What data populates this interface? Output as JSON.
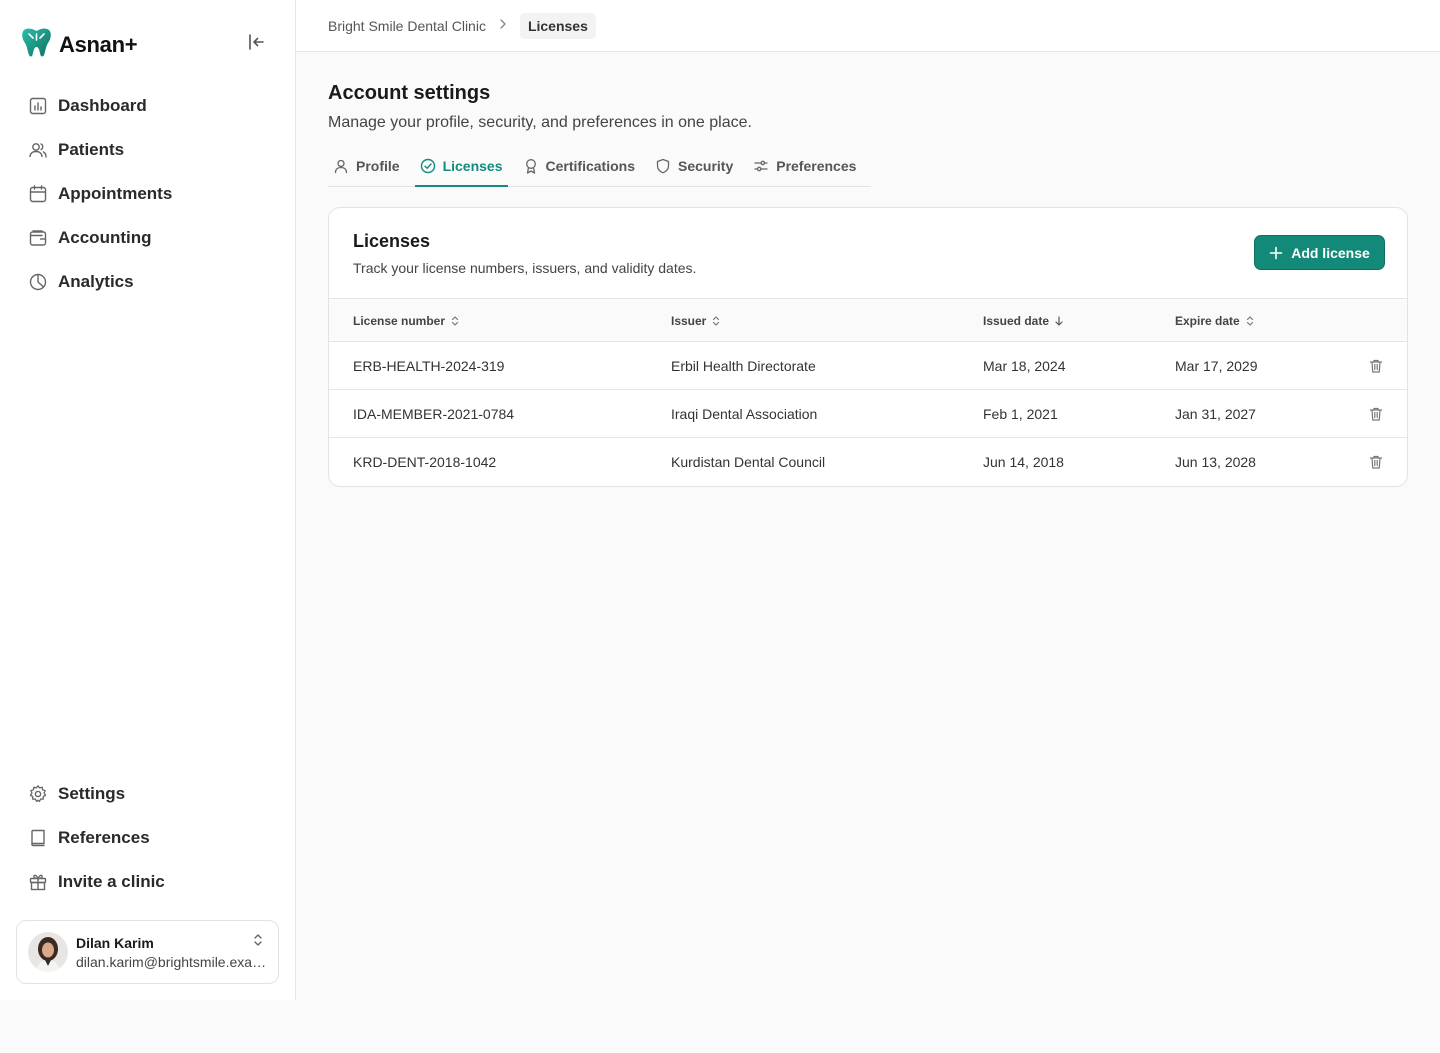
{
  "app": {
    "name": "Asnan+",
    "accent": "#128c7e"
  },
  "sidebar": {
    "items": [
      {
        "label": "Dashboard",
        "icon": "bar-chart-icon"
      },
      {
        "label": "Patients",
        "icon": "users-icon"
      },
      {
        "label": "Appointments",
        "icon": "calendar-icon"
      },
      {
        "label": "Accounting",
        "icon": "wallet-icon"
      },
      {
        "label": "Analytics",
        "icon": "pie-chart-icon"
      }
    ],
    "bottom_items": [
      {
        "label": "Settings",
        "icon": "gear-icon"
      },
      {
        "label": "References",
        "icon": "book-icon"
      },
      {
        "label": "Invite a clinic",
        "icon": "gift-icon"
      }
    ],
    "user": {
      "name": "Dilan Karim",
      "email": "dilan.karim@brightsmile.example"
    }
  },
  "breadcrumb": {
    "clinic": "Bright Smile Dental Clinic",
    "current": "Licenses"
  },
  "page": {
    "title": "Account settings",
    "subtitle": "Manage your profile, security, and preferences in one place.",
    "tabs": [
      {
        "label": "Profile",
        "icon": "user-icon"
      },
      {
        "label": "Licenses",
        "icon": "check-circle-icon",
        "active": true
      },
      {
        "label": "Certifications",
        "icon": "award-icon"
      },
      {
        "label": "Security",
        "icon": "shield-icon"
      },
      {
        "label": "Preferences",
        "icon": "sliders-icon"
      }
    ]
  },
  "licenses": {
    "title": "Licenses",
    "subtitle": "Track your license numbers, issuers, and validity dates.",
    "add_label": "Add license",
    "columns": [
      {
        "label": "License number",
        "sort": "none"
      },
      {
        "label": "Issuer",
        "sort": "none"
      },
      {
        "label": "Issued date",
        "sort": "desc"
      },
      {
        "label": "Expire date",
        "sort": "none"
      }
    ],
    "rows": [
      {
        "number": "ERB-HEALTH-2024-319",
        "issuer": "Erbil Health Directorate",
        "issued": "Mar 18, 2024",
        "expires": "Mar 17, 2029"
      },
      {
        "number": "IDA-MEMBER-2021-0784",
        "issuer": "Iraqi Dental Association",
        "issued": "Feb 1, 2021",
        "expires": "Jan 31, 2027"
      },
      {
        "number": "KRD-DENT-2018-1042",
        "issuer": "Kurdistan Dental Council",
        "issued": "Jun 14, 2018",
        "expires": "Jun 13, 2028"
      }
    ]
  }
}
